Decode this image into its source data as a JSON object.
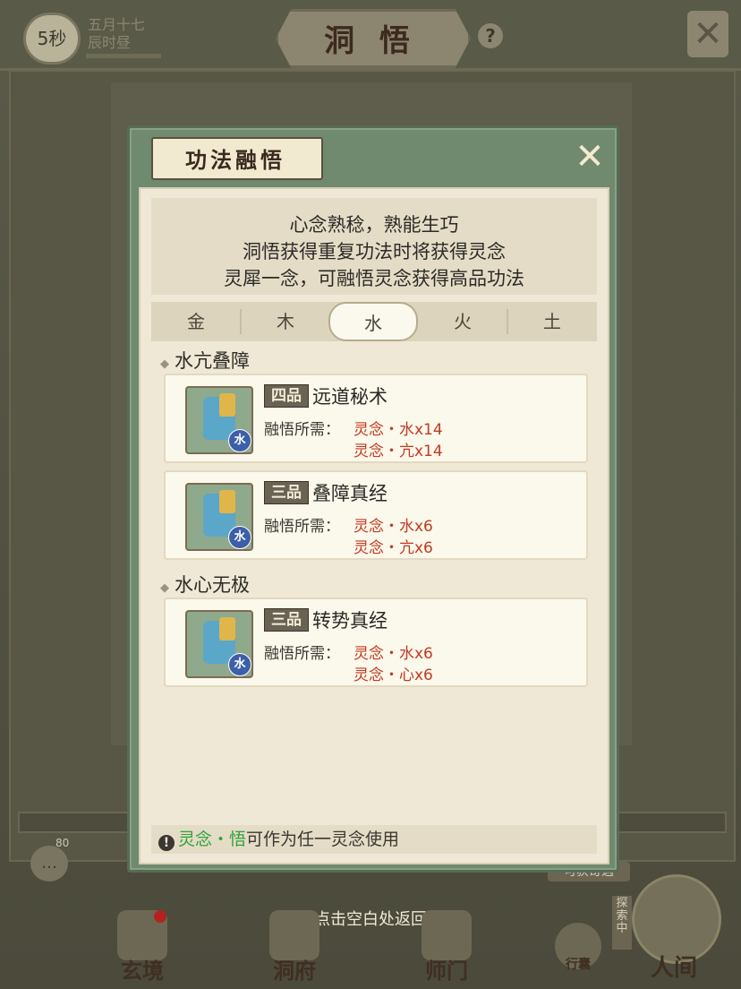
{
  "header": {
    "timer": "5秒",
    "date_line1": "五月十七",
    "date_line2": "辰时昼",
    "title": "洞 悟",
    "help": "?",
    "close": "✕"
  },
  "modal": {
    "title": "功法融悟",
    "close": "✕",
    "intro": [
      "心念熟稔，熟能生巧",
      "洞悟获得重复功法时将获得灵念",
      "灵犀一念，可融悟灵念获得高品功法"
    ],
    "tabs": [
      "金",
      "木",
      "水",
      "火",
      "土"
    ],
    "selected_tab": "水",
    "groups": [
      {
        "title": "水亢叠障",
        "items": [
          {
            "grade": "四品",
            "name": "远道秘术",
            "req_label": "融悟所需：",
            "req1": "灵念・水x14",
            "req2": "灵念・亢x14",
            "element_badge": "水"
          },
          {
            "grade": "三品",
            "name": "叠障真经",
            "req_label": "融悟所需：",
            "req1": "灵念・水x6",
            "req2": "灵念・亢x6",
            "element_badge": "水"
          }
        ]
      },
      {
        "title": "水心无极",
        "items": [
          {
            "grade": "三品",
            "name": "转势真经",
            "req_label": "融悟所需：",
            "req1": "灵念・水x6",
            "req2": "灵念・心x6",
            "element_badge": "水"
          }
        ]
      }
    ],
    "footer": {
      "icon": "!",
      "accent": "灵念・悟",
      "text": "可作为任一灵念使用"
    }
  },
  "bottom": {
    "back_hint": "点击空白处返回",
    "chat_count": "80",
    "rewards_tag": "可获奇遇",
    "explore_tag": "探索中",
    "nav": [
      "玄境",
      "洞府",
      "师门"
    ],
    "bag": "行囊",
    "world": "人间"
  },
  "colors": {
    "modal_frame": "#6f8a6e",
    "requirement_red": "#c23a21",
    "accent_green": "#2fa23c"
  }
}
